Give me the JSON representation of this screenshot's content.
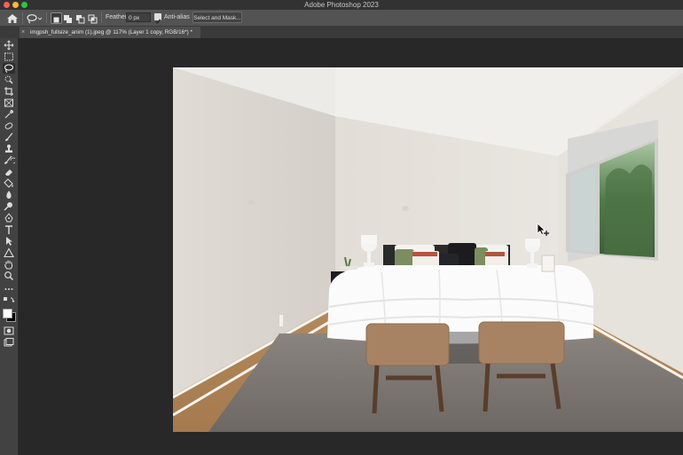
{
  "window": {
    "app_title": "Adobe Photoshop 2023",
    "traffic_lights": {
      "close": "#fe5f57",
      "minimize": "#febc2e",
      "zoom": "#28c840"
    }
  },
  "options_bar": {
    "feather_label": "Feather:",
    "feather_value": "0 px",
    "anti_alias_label": "Anti-alias",
    "anti_alias_checked": true,
    "select_and_mask_label": "Select and Mask..."
  },
  "document_tab": {
    "close_glyph": "×",
    "title": "imgpsh_fullsize_anim (1).jpeg @ 117% (Layer 1 copy, RGB/16*) *"
  },
  "toolbar": {
    "tools": [
      "move-icon",
      "marquee-icon",
      "lasso-icon",
      "quick-select-icon",
      "crop-icon",
      "frame-icon",
      "eyedropper-icon",
      "healing-icon",
      "brush-icon",
      "stamp-icon",
      "history-brush-icon",
      "eraser-icon",
      "gradient-icon",
      "blur-icon",
      "dodge-icon",
      "pen-icon",
      "type-icon",
      "path-select-icon",
      "shape-icon",
      "hand-icon",
      "zoom-icon",
      "more-icon"
    ],
    "active_tool": "lasso-icon",
    "foreground_color": "#ffffff",
    "background_color": "#000000"
  },
  "colors": {
    "ui_dark": "#282828",
    "options_bar": "#535353",
    "toolbar": "#424242"
  }
}
